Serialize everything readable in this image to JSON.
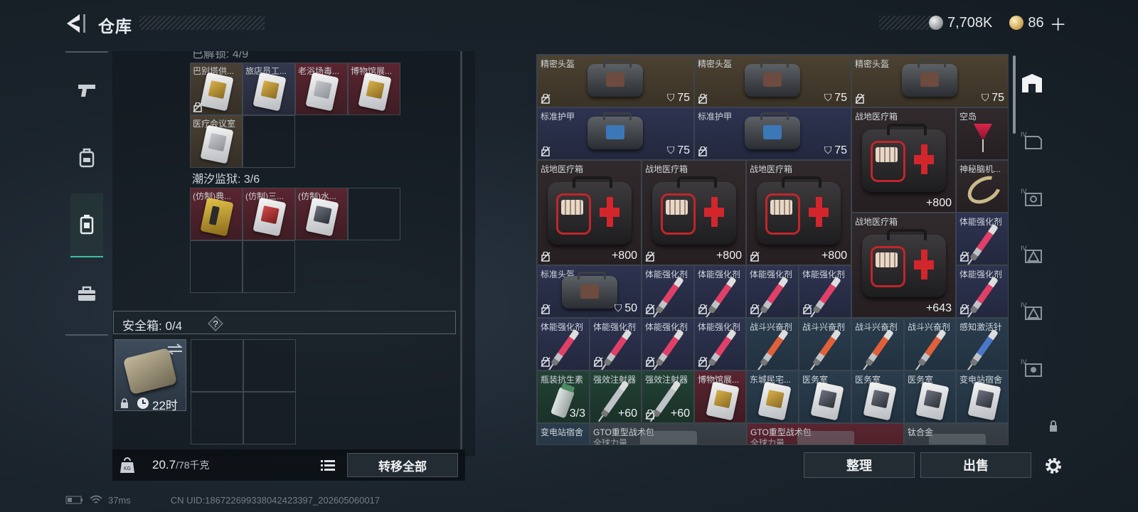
{
  "header": {
    "title": "仓库"
  },
  "currency": {
    "silver": "7,708K",
    "gold": "86"
  },
  "stash": {
    "section1_label": "已解锁: 4/9",
    "row1": [
      "巴别塔供...",
      "旅店员工...",
      "老浴场毒...",
      "博物馆展..."
    ],
    "row2": [
      "医疗会议室"
    ],
    "section2_label": "潮汐监狱: 3/6",
    "row3": [
      "(仿制)典...",
      "(仿制)三...",
      "(仿制)水..."
    ]
  },
  "safebox": {
    "label": "安全箱: 0/4",
    "help": "?",
    "timer": "22时"
  },
  "bottom": {
    "weight_current": "20.7",
    "weight_max": "/78千克",
    "transfer_label": "转移全部"
  },
  "status": {
    "ping": "37ms",
    "uid": "CN UID:18672269933804242339​7_202605060017"
  },
  "inventory": {
    "helmet1": {
      "name": "精密头盔",
      "value": "75"
    },
    "helmet2": {
      "name": "精密头盔",
      "value": "75"
    },
    "helmet3": {
      "name": "精密头盔",
      "value": "75"
    },
    "armor1": {
      "name": "标准护甲",
      "value": "75"
    },
    "armor2": {
      "name": "标准护甲",
      "value": "75"
    },
    "medkit_big1": {
      "name": "战地医疗箱",
      "value": "+800"
    },
    "cocktail": {
      "name": "空岛"
    },
    "medkit1": {
      "name": "战地医疗箱",
      "value": "+800"
    },
    "medkit2": {
      "name": "战地医疗箱",
      "value": "+800"
    },
    "medkit3": {
      "name": "战地医疗箱",
      "value": "+800"
    },
    "device": {
      "name": "神秘脑机..."
    },
    "medkit_big2": {
      "name": "战地医疗箱",
      "value": "+643"
    },
    "stim_r": {
      "name": "体能强化剂"
    },
    "helmet4": {
      "name": "标准头盔",
      "value": "50"
    },
    "row5": [
      "体能强化剂",
      "体能强化剂",
      "体能强化剂",
      "体能强化剂",
      "体能强化剂"
    ],
    "row6a": [
      "体能强化剂",
      "体能强化剂",
      "体能强化剂",
      "体能强化剂"
    ],
    "row6b": [
      "战斗兴奋剂",
      "战斗兴奋剂",
      "战斗兴奋剂",
      "战斗兴奋剂"
    ],
    "row6c": "感知激活针",
    "antibiotic": {
      "name": "瓶装抗生素",
      "value": "3/3"
    },
    "injector1": {
      "name": "强效注射器",
      "value": "+60"
    },
    "injector2": {
      "name": "强效注射器",
      "value": "+60"
    },
    "cards": [
      "博物馆展...",
      "东城民宅...",
      "医务室",
      "医务室",
      "医务室",
      "变电站宿舍"
    ],
    "bottom_row": {
      "a": "变电站宿舍",
      "b": "GTO重型战术包",
      "b_sub": "全球力量",
      "c": "GTO重型战术包",
      "c_sub": "全球力量",
      "d": "钛合金"
    }
  },
  "actions": {
    "tidy": "整理",
    "sell": "出售"
  },
  "colors": {
    "accent": "#3fbfa0",
    "danger": "#c0262a"
  }
}
